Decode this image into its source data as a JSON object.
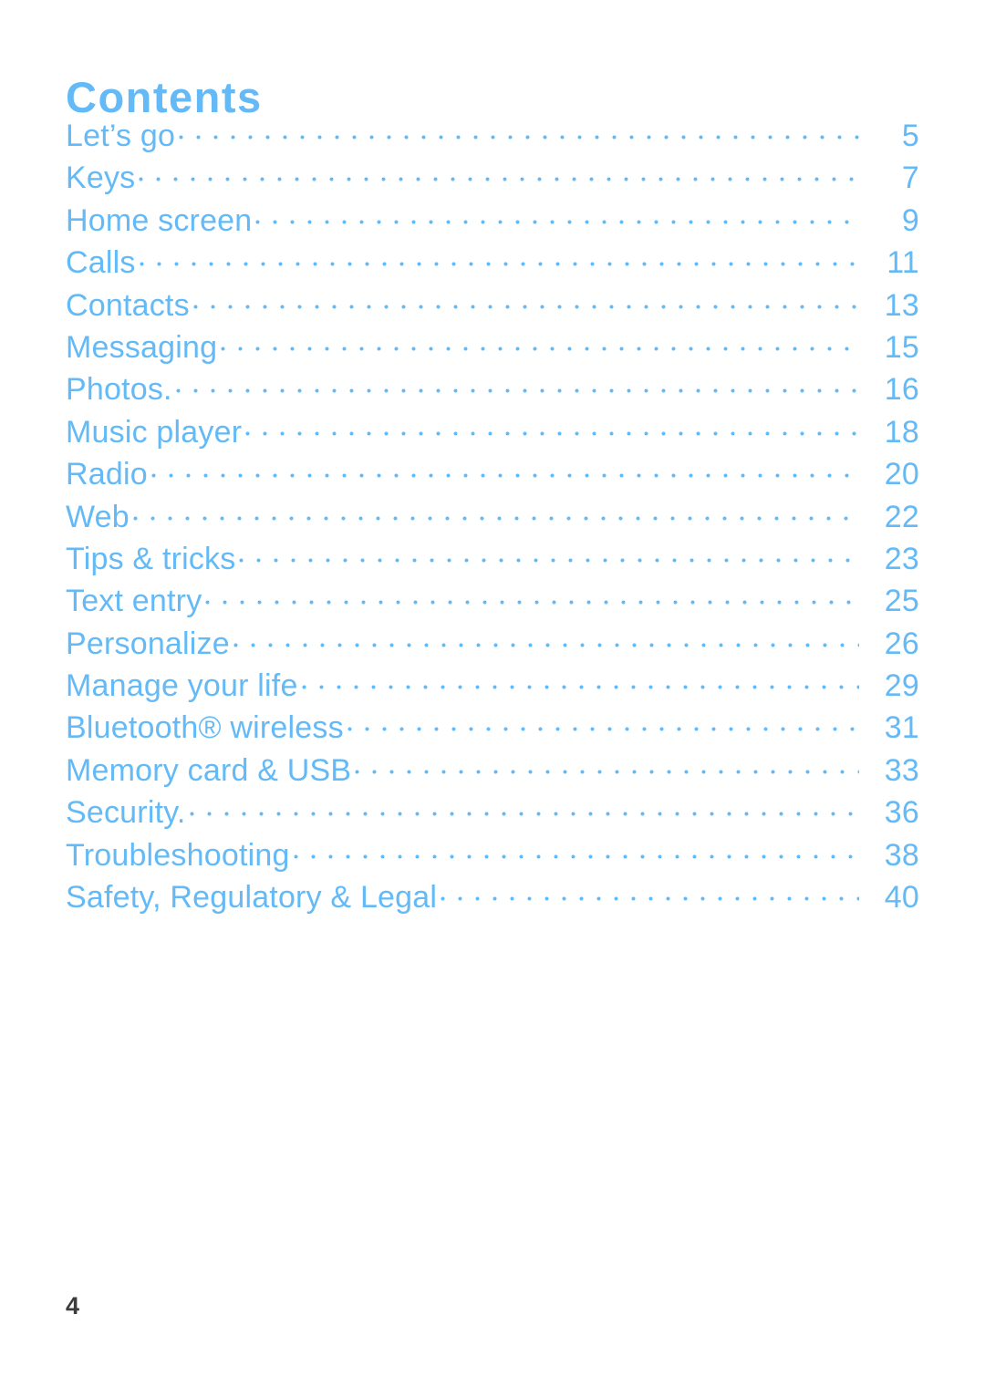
{
  "document": {
    "title": "Contents",
    "accent_color": "#63baf6",
    "footer_color": "#3c3c3c",
    "background_color": "#ffffff",
    "footer_page_number": "4"
  },
  "toc": {
    "entries": [
      {
        "label": "Let’s go",
        "page": "5"
      },
      {
        "label": "Keys",
        "page": "7"
      },
      {
        "label": "Home screen",
        "page": "9"
      },
      {
        "label": "Calls",
        "page": "11"
      },
      {
        "label": "Contacts",
        "page": "13"
      },
      {
        "label": "Messaging",
        "page": "15"
      },
      {
        "label": "Photos.",
        "page": "16"
      },
      {
        "label": "Music player",
        "page": "18"
      },
      {
        "label": "Radio",
        "page": "20"
      },
      {
        "label": "Web",
        "page": "22"
      },
      {
        "label": "Tips & tricks",
        "page": "23"
      },
      {
        "label": "Text entry",
        "page": "25"
      },
      {
        "label": "Personalize",
        "page": "26"
      },
      {
        "label": "Manage your life",
        "page": "29"
      },
      {
        "label": "Bluetooth® wireless",
        "page": "31"
      },
      {
        "label": "Memory card & USB",
        "page": "33"
      },
      {
        "label": "Security.",
        "page": "36"
      },
      {
        "label": "Troubleshooting",
        "page": "38"
      },
      {
        "label": "Safety, Regulatory & Legal",
        "page": "40"
      }
    ]
  }
}
